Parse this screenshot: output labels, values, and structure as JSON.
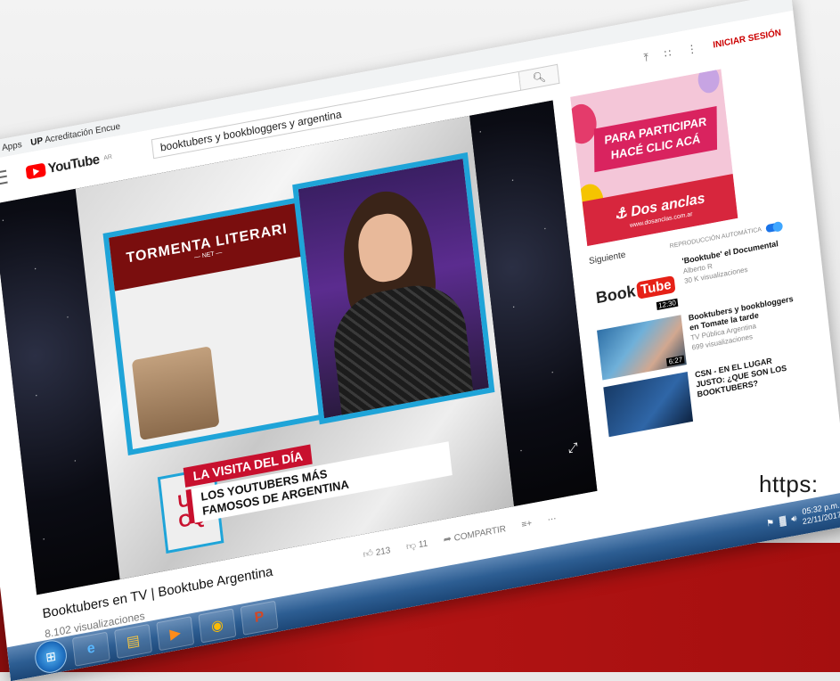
{
  "browser": {
    "bookmarks": [
      {
        "label": "Apps",
        "icon": "apps-grid-icon"
      },
      {
        "label": "Acreditación Encue",
        "prefix": "UP"
      }
    ]
  },
  "youtube": {
    "logo_text": "YouTube",
    "region": "AR",
    "search_query": "booktubers y bookbloggers y argentina",
    "signin_label": "INICIAR SESIÓN",
    "upload_icon": "upload-icon",
    "apps_icon": "apps-grid-icon",
    "more_icon": "more-vert-icon"
  },
  "video": {
    "title": "Booktubers en TV | Booktube Argentina",
    "views": "8.102 visualizaciones",
    "likes": "213",
    "dislikes": "11",
    "share_label": "COMPARTIR",
    "overlay": {
      "site_title": "TORMENTA LITERARI",
      "site_sub": "— NET —",
      "lower_third_1": "LA VISITA DEL DÍA",
      "lower_third_2": "LOS YOUTUBERS MÁS",
      "lower_third_3": "FAMOSOS DE ARGENTINA",
      "badge_line1": "UT",
      "badge_line2": "CQ"
    }
  },
  "sidebar": {
    "ad": {
      "line1": "PARA PARTICIPAR",
      "line2": "HACÉ CLIC ACÁ",
      "brand": "Dos anclas",
      "url": "www.dosanclas.com.ar"
    },
    "next_label": "Siguiente",
    "autoplay_label": "REPRODUCCIÓN AUTOMÁTICA",
    "recommendations": [
      {
        "title": "'Booktube' el Documental",
        "channel": "Alberto R",
        "views": "30 K visualizaciones",
        "duration": "12:30",
        "thumb_text_1": "Book",
        "thumb_text_2": "Tube"
      },
      {
        "title": "Booktubers y bookbloggers en Tomate la tarde",
        "channel": "TV Pública Argentina",
        "views": "699 visualizaciones",
        "duration": "6:27"
      },
      {
        "title": "CSN - EN EL LUGAR JUSTO: ¿QUE SON LOS BOOKTUBERS?",
        "channel": "",
        "views": "",
        "duration": ""
      }
    ]
  },
  "taskbar": {
    "apps": [
      "ie-icon",
      "folder-icon",
      "media-player-icon",
      "chrome-icon",
      "powerpoint-icon"
    ],
    "time": "05:32 p.m.",
    "date": "22/11/2017"
  },
  "slide": {
    "url_fragment": "https:",
    "accent_red": "#b31414"
  }
}
